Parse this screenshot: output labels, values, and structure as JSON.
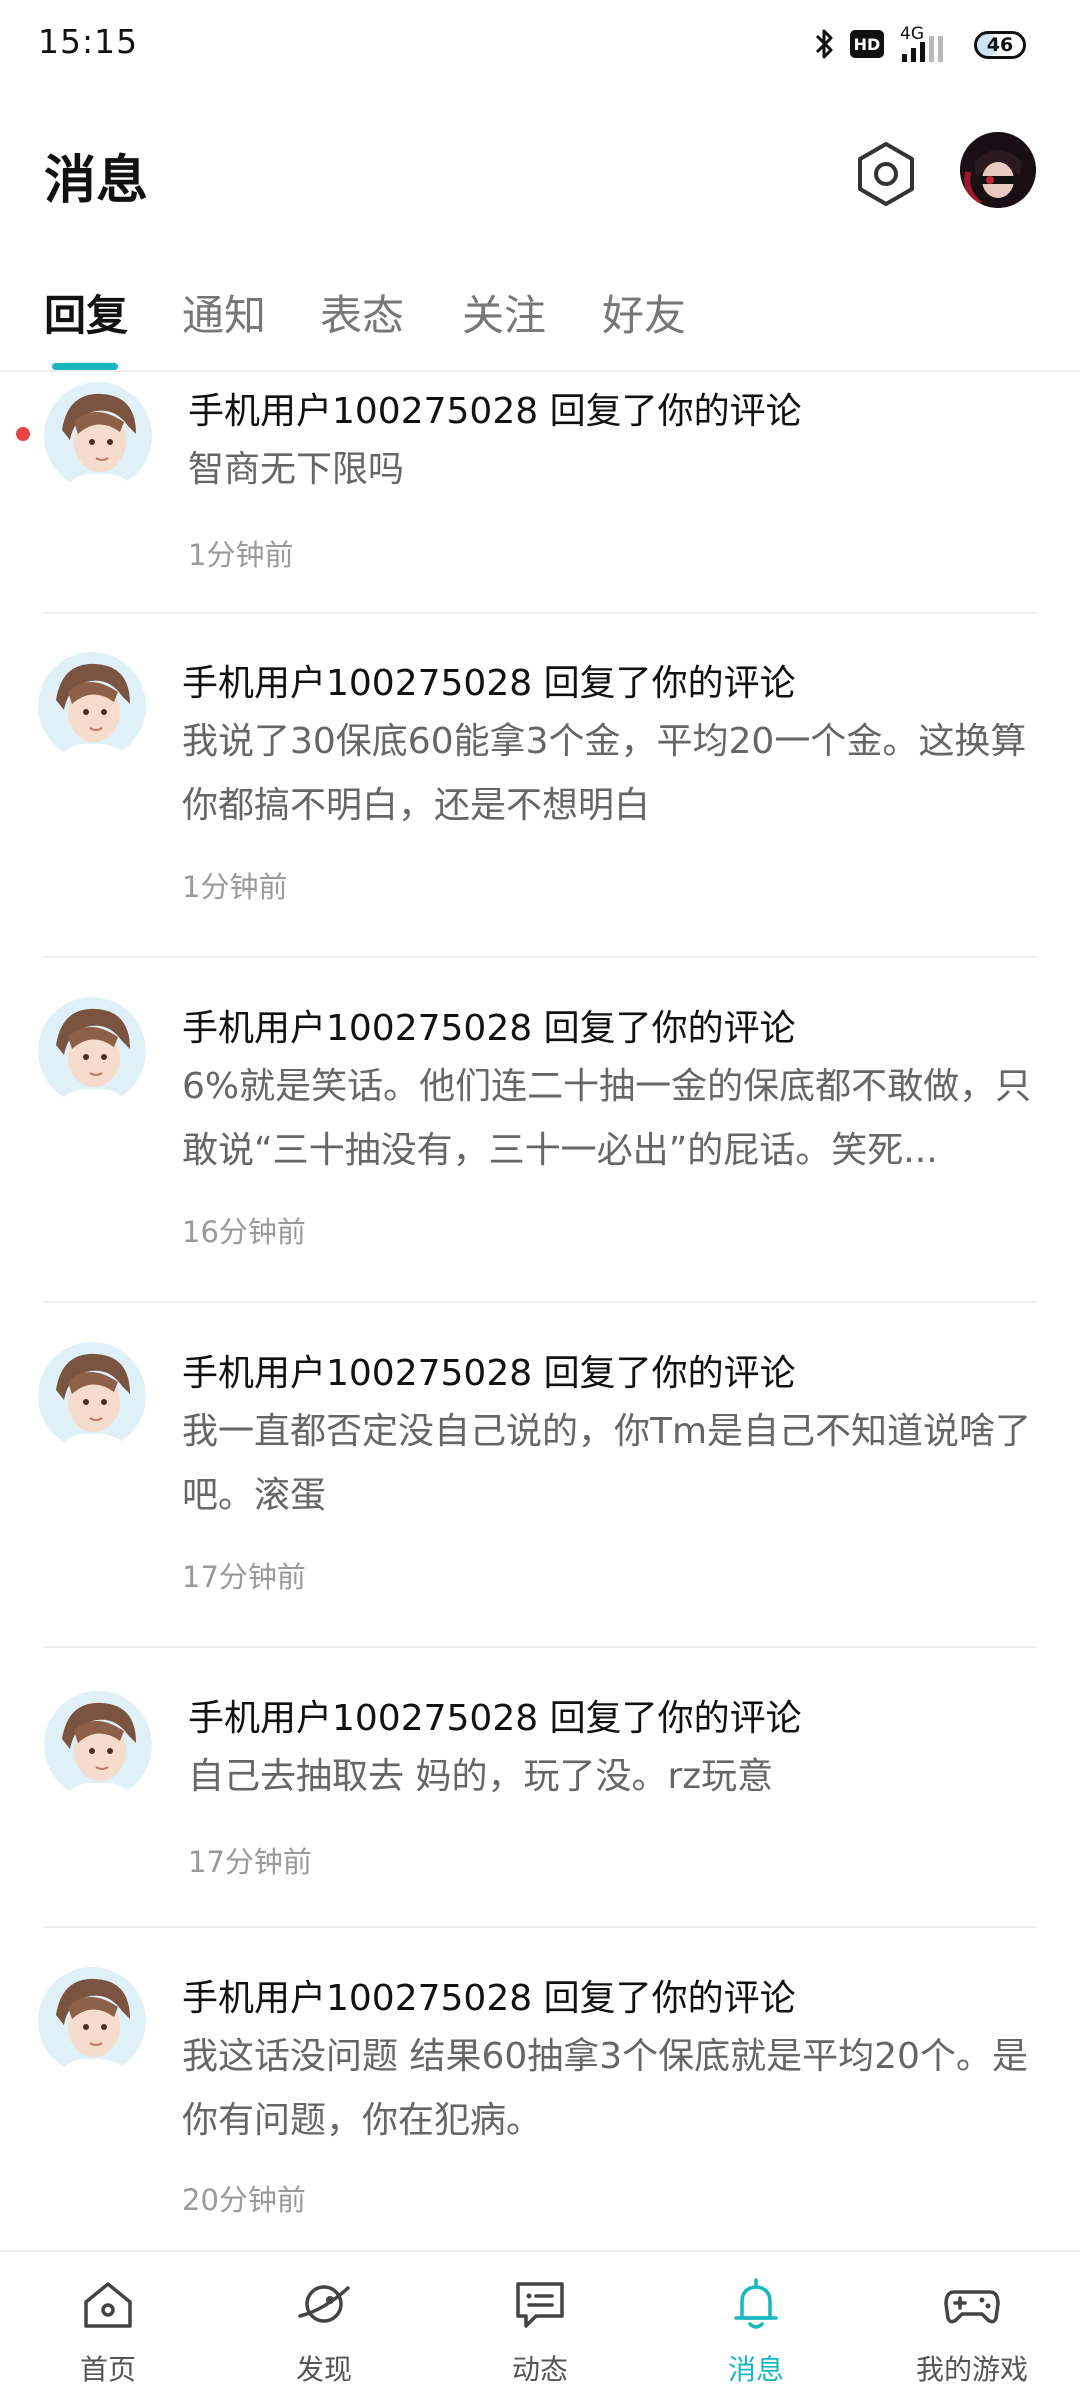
{
  "status_bar": {
    "time": "15:15",
    "network": "4G",
    "hd_badge": "HD",
    "battery": "46",
    "battery_level_percent": 46,
    "icons": [
      "bluetooth-icon",
      "hd-icon",
      "signal-icon",
      "battery-icon"
    ]
  },
  "header": {
    "title": "消息",
    "settings_icon": "hexagon-settings-icon",
    "avatar": "user-avatar"
  },
  "tabs": [
    {
      "label": "回复",
      "active": true
    },
    {
      "label": "通知",
      "active": false
    },
    {
      "label": "表态",
      "active": false
    },
    {
      "label": "关注",
      "active": false
    },
    {
      "label": "好友",
      "active": false
    }
  ],
  "messages": [
    {
      "title": "手机用户100275028 回复了你的评论",
      "body": "智商无下限吗",
      "time": "1分钟前",
      "unread": true
    },
    {
      "title": "手机用户100275028 回复了你的评论",
      "body": "我说了30保底60能拿3个金，平均20一个金。这换算你都搞不明白，还是不想明白",
      "time": "1分钟前",
      "unread": false
    },
    {
      "title": "手机用户100275028 回复了你的评论",
      "body": "6%就是笑话。他们连二十抽一金的保底都不敢做，只敢说“三十抽没有，三十一必出”的屁话。笑死...",
      "time": "16分钟前",
      "unread": false
    },
    {
      "title": "手机用户100275028 回复了你的评论",
      "body": "我一直都否定没自己说的，你Tm是自己不知道说啥了吧。滚蛋",
      "time": "17分钟前",
      "unread": false
    },
    {
      "title": "手机用户100275028 回复了你的评论",
      "body": "自己去抽取去 妈的，玩了没。rz玩意",
      "time": "17分钟前",
      "unread": false
    },
    {
      "title": "手机用户100275028 回复了你的评论",
      "body": "我这话没问题  结果60抽拿3个保底就是平均20个。是你有问题，你在犯病。",
      "time": "20分钟前",
      "unread": false
    }
  ],
  "bottom_nav": [
    {
      "label": "首页",
      "icon": "home-icon",
      "active": false
    },
    {
      "label": "发现",
      "icon": "planet-icon",
      "active": false
    },
    {
      "label": "动态",
      "icon": "chat-bubble-icon",
      "active": false
    },
    {
      "label": "消息",
      "icon": "bell-icon",
      "active": true
    },
    {
      "label": "我的游戏",
      "icon": "gamepad-icon",
      "active": false
    }
  ],
  "colors": {
    "accent": "#19b8bf",
    "unread_dot": "#e84545",
    "text_primary": "#111111",
    "text_secondary": "#666666",
    "text_muted": "#9a9a9a"
  }
}
